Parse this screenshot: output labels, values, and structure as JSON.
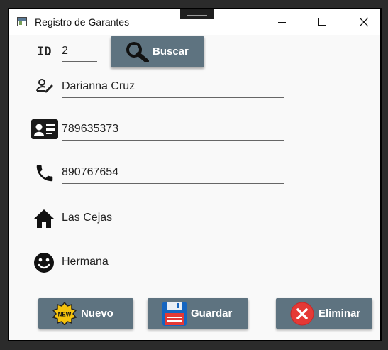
{
  "window": {
    "title": "Registro de Garantes",
    "controls": [
      "minimize",
      "maximize",
      "close"
    ]
  },
  "form": {
    "id_label": "ID",
    "id_value": "2",
    "search_button": "Buscar",
    "name": "Darianna Cruz",
    "cedula": "789635373",
    "phone": "890767654",
    "address": "Las Cejas",
    "relationship": "Hermana"
  },
  "buttons": {
    "new": "Nuevo",
    "new_badge": "NEW",
    "save": "Guardar",
    "delete": "Eliminar"
  },
  "icons": {
    "name": "person-edit-icon",
    "cedula": "id-card-icon",
    "phone": "phone-icon",
    "address": "home-icon",
    "relationship": "smiley-face-icon",
    "search": "magnifier-icon",
    "new": "new-badge-icon",
    "save": "floppy-disk-icon",
    "delete": "delete-x-icon"
  },
  "colors": {
    "button_bg": "#5e7380",
    "window_bg": "#f9f9f9",
    "delete_red": "#e53935"
  }
}
